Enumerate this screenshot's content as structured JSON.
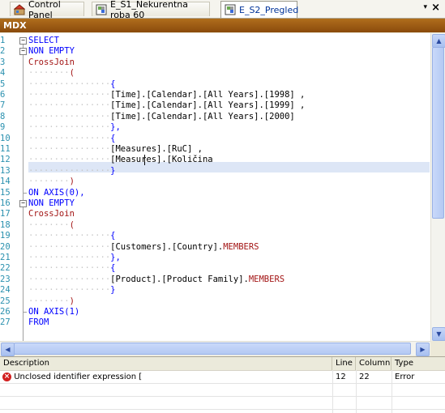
{
  "tabs": [
    {
      "label": "Control Panel",
      "icon": "control-panel-icon"
    },
    {
      "label": "E_S1_Nekurentna roba 60",
      "icon": "cube-icon"
    },
    {
      "label": "E_S2_Pregled",
      "icon": "cube-icon"
    }
  ],
  "tab_menu_glyph": "▾",
  "close_glyph": "×",
  "panel_title": "MDX",
  "editor": {
    "line_numbers": [
      "1",
      "2",
      "3",
      "4",
      "5",
      "6",
      "7",
      "8",
      "9",
      "10",
      "11",
      "12",
      "13",
      "14",
      "15",
      "16",
      "17",
      "18",
      "19",
      "20",
      "21",
      "22",
      "23",
      "24",
      "25",
      "26",
      "27"
    ],
    "lines": [
      {
        "indent": "",
        "kw": "SELECT",
        "text": ""
      },
      {
        "indent": "",
        "kw": "NON EMPTY",
        "text": ""
      },
      {
        "indent": "",
        "kw": "",
        "text": "",
        "rd": "CrossJoin"
      },
      {
        "indent": "········",
        "kw": "",
        "text": "",
        "rd": "("
      },
      {
        "indent": "················",
        "kw": "{",
        "text": ""
      },
      {
        "indent": "················",
        "kw": "",
        "text": "[Time].[Calendar].[All Years].[1998] ,"
      },
      {
        "indent": "················",
        "kw": "",
        "text": "[Time].[Calendar].[All Years].[1999] ,"
      },
      {
        "indent": "················",
        "kw": "",
        "text": "[Time].[Calendar].[All Years].[2000]"
      },
      {
        "indent": "················",
        "kw": "},",
        "text": ""
      },
      {
        "indent": "················",
        "kw": "{",
        "text": ""
      },
      {
        "indent": "················",
        "kw": "",
        "text": "[Measures].[RuC] ,"
      },
      {
        "indent": "················",
        "kw": "",
        "text": "[Measures].[Količina"
      },
      {
        "indent": "················",
        "kw": "}",
        "text": ""
      },
      {
        "indent": "········",
        "kw": "",
        "text": "",
        "rd": ")"
      },
      {
        "indent": "",
        "kw": "ON AXIS(0),",
        "text": ""
      },
      {
        "indent": "",
        "kw": "NON EMPTY",
        "text": ""
      },
      {
        "indent": "",
        "kw": "",
        "text": "",
        "rd": "CrossJoin"
      },
      {
        "indent": "········",
        "kw": "",
        "text": "",
        "rd": "("
      },
      {
        "indent": "················",
        "kw": "{",
        "text": ""
      },
      {
        "indent": "················",
        "kw": "",
        "text": "[Customers].[Country].",
        "rd": "MEMBERS"
      },
      {
        "indent": "················",
        "kw": "},",
        "text": ""
      },
      {
        "indent": "················",
        "kw": "{",
        "text": ""
      },
      {
        "indent": "················",
        "kw": "",
        "text": "[Product].[Product Family].",
        "rd": "MEMBERS"
      },
      {
        "indent": "················",
        "kw": "}",
        "text": ""
      },
      {
        "indent": "········",
        "kw": "",
        "text": "",
        "rd": ")"
      },
      {
        "indent": "",
        "kw": "ON AXIS(1)",
        "text": ""
      },
      {
        "indent": "",
        "kw": "FROM",
        "text": ""
      }
    ]
  },
  "error_list": {
    "columns": [
      "Description",
      "Line",
      "Column",
      "Type"
    ],
    "rows": [
      {
        "description": "Unclosed identifier expression [",
        "line": "12",
        "column": "22",
        "type": "Error"
      }
    ]
  },
  "colors": {
    "header_brown": "#9a5a14",
    "keyword": "#0000ff",
    "function": "#a31515",
    "line_number": "#2b91af"
  }
}
